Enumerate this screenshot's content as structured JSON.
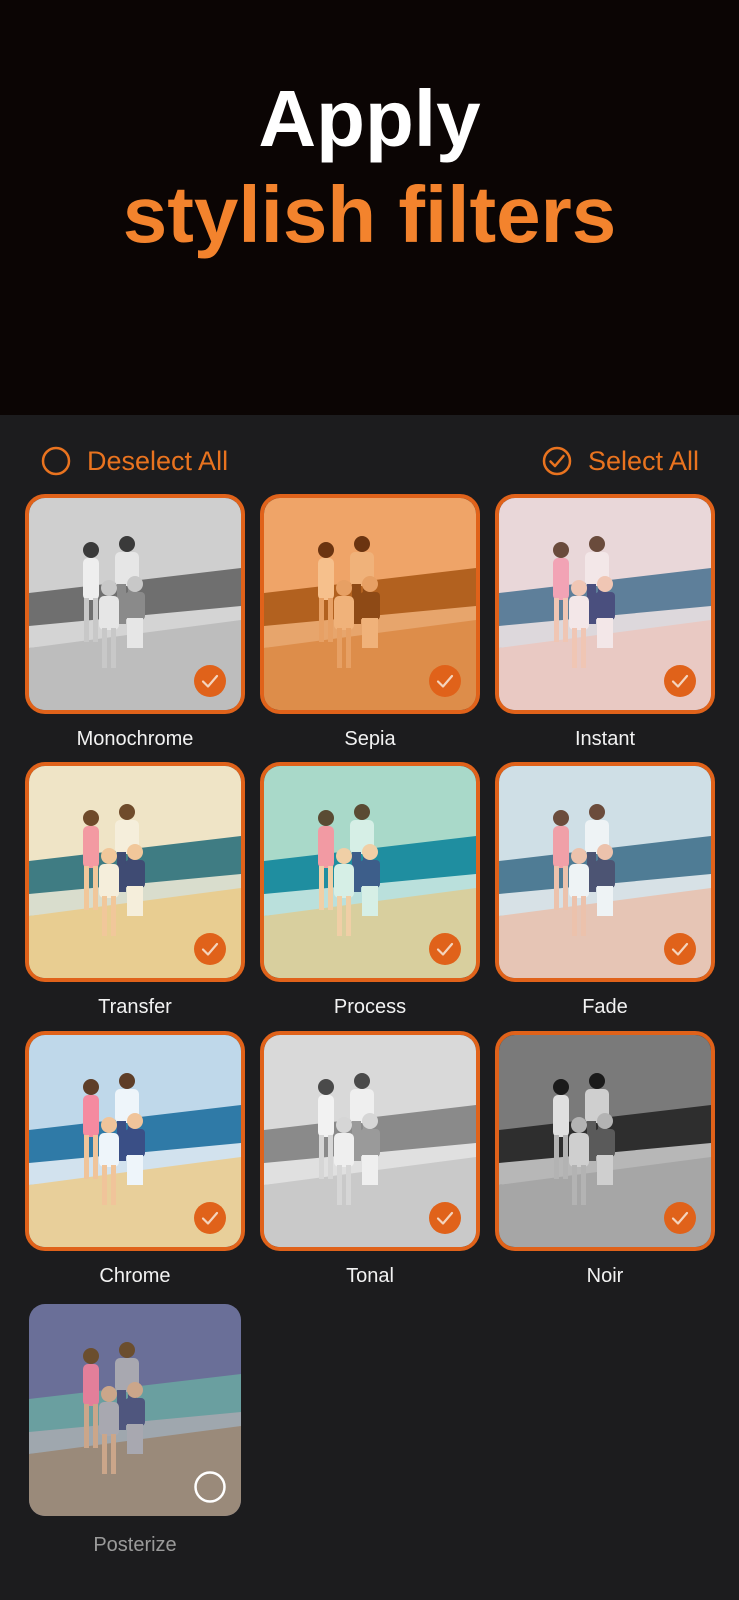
{
  "hero": {
    "line1": "Apply",
    "line2": "stylish filters"
  },
  "toolbar": {
    "deselect_label": "Deselect All",
    "select_label": "Select All"
  },
  "colors": {
    "accent": "#e9731f",
    "hero_orange": "#f3832d",
    "panel_bg": "#1c1c1e",
    "hero_bg": "#0b0504"
  },
  "filters": [
    {
      "name": "Monochrome",
      "selected": true
    },
    {
      "name": "Sepia",
      "selected": true
    },
    {
      "name": "Instant",
      "selected": true
    },
    {
      "name": "Transfer",
      "selected": true
    },
    {
      "name": "Process",
      "selected": true
    },
    {
      "name": "Fade",
      "selected": true
    },
    {
      "name": "Chrome",
      "selected": true
    },
    {
      "name": "Tonal",
      "selected": true
    },
    {
      "name": "Noir",
      "selected": true
    },
    {
      "name": "Posterize",
      "selected": false
    }
  ]
}
